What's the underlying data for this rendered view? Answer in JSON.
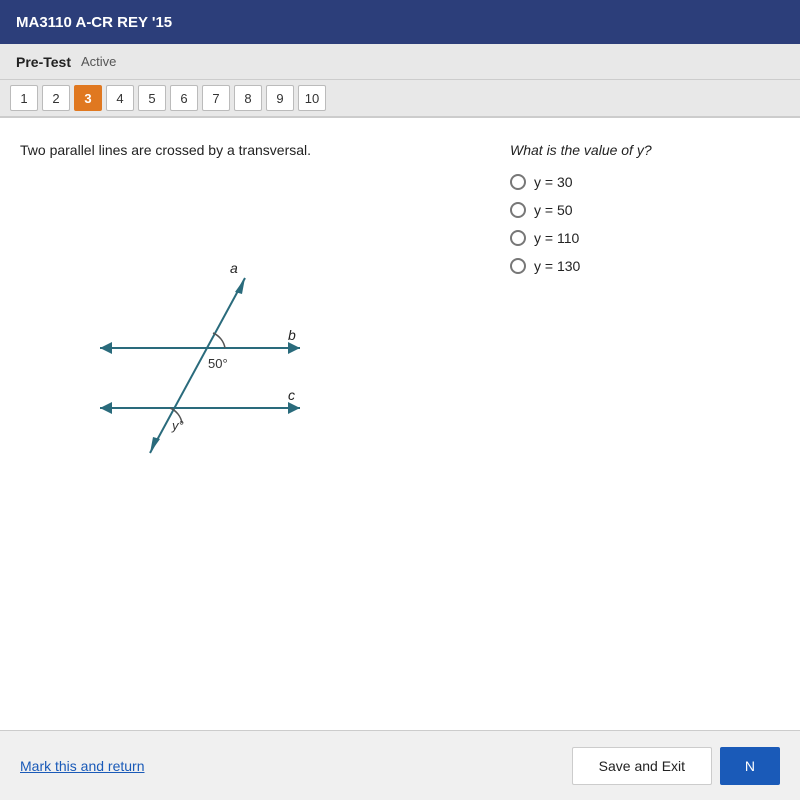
{
  "header": {
    "title": "MA3110 A-CR REY '15"
  },
  "subheader": {
    "label": "Pre-Test",
    "status": "Active"
  },
  "nav": {
    "tabs": [
      {
        "number": "1",
        "state": "normal"
      },
      {
        "number": "2",
        "state": "normal"
      },
      {
        "number": "3",
        "state": "active"
      },
      {
        "number": "4",
        "state": "normal"
      },
      {
        "number": "5",
        "state": "normal"
      },
      {
        "number": "6",
        "state": "normal"
      },
      {
        "number": "7",
        "state": "normal"
      },
      {
        "number": "8",
        "state": "normal"
      },
      {
        "number": "9",
        "state": "normal"
      },
      {
        "number": "10",
        "state": "normal"
      }
    ]
  },
  "question": {
    "text": "Two parallel lines are crossed by a transversal.",
    "title": "What is the value of y?",
    "answers": [
      {
        "id": "a1",
        "label": "y = 30"
      },
      {
        "id": "a2",
        "label": "y = 50"
      },
      {
        "id": "a3",
        "label": "y = 110"
      },
      {
        "id": "a4",
        "label": "y = 130"
      }
    ]
  },
  "footer": {
    "mark_return": "Mark this and return",
    "save_exit": "Save and Exit",
    "next": "N"
  }
}
